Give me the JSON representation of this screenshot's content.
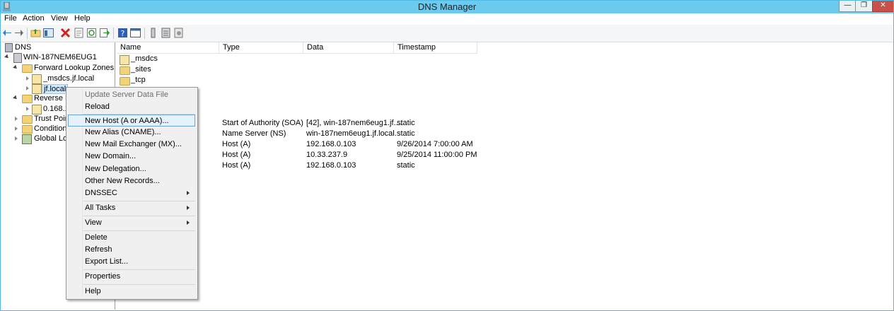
{
  "window": {
    "title": "DNS Manager",
    "controls": {
      "minimize": "—",
      "maximize": "❐",
      "close": "✕"
    }
  },
  "menubar": {
    "items": [
      "File",
      "Action",
      "View",
      "Help"
    ]
  },
  "toolbar": {
    "icons": [
      "back-icon",
      "forward-icon",
      "up-folder-icon",
      "show-hide-tree-icon",
      "delete-icon",
      "properties-icon",
      "refresh-icon",
      "export-icon",
      "help-icon",
      "console-view-icon",
      "server-icon",
      "list-icon",
      "settings-icon"
    ]
  },
  "tree": {
    "root": "DNS",
    "server": "WIN-187NEM6EUG1",
    "forward_zones": "Forward Lookup Zones",
    "zone_msdcs": "_msdcs.jf.local",
    "zone_jf": "jf.local",
    "reverse_zones": "Reverse Lo",
    "reverse_zone": "0.168.1",
    "trust_points": "Trust Point",
    "conditional": "Conditiona",
    "global_logs": "Global Log"
  },
  "list": {
    "columns": [
      "Name",
      "Type",
      "Data",
      "Timestamp"
    ],
    "folders": [
      "_msdcs",
      "_sites",
      "_tcp"
    ],
    "records": [
      {
        "type": "Start of Authority (SOA)",
        "data": "[42], win-187nem6eug1.jf....",
        "timestamp": "static"
      },
      {
        "type": "Name Server (NS)",
        "data": "win-187nem6eug1.jf.local.",
        "timestamp": "static"
      },
      {
        "type": "Host (A)",
        "data": "192.168.0.103",
        "timestamp": "9/26/2014 7:00:00 AM"
      },
      {
        "type": "Host (A)",
        "data": "10.33.237.9",
        "timestamp": "9/25/2014 11:00:00 PM"
      },
      {
        "type": "Host (A)",
        "data": "192.168.0.103",
        "timestamp": "static"
      }
    ]
  },
  "context_menu": {
    "items": [
      {
        "label": "Update Server Data File"
      },
      {
        "label": "Reload"
      },
      {
        "label": "New Host (A or AAAA)..."
      },
      {
        "label": "New Alias (CNAME)..."
      },
      {
        "label": "New Mail Exchanger (MX)..."
      },
      {
        "label": "New Domain..."
      },
      {
        "label": "New Delegation..."
      },
      {
        "label": "Other New Records..."
      },
      {
        "label": "DNSSEC"
      },
      {
        "label": "All Tasks"
      },
      {
        "label": "View"
      },
      {
        "label": "Delete"
      },
      {
        "label": "Refresh"
      },
      {
        "label": "Export List..."
      },
      {
        "label": "Properties"
      },
      {
        "label": "Help"
      }
    ]
  },
  "colors": {
    "titlebar": "#6ccaed",
    "close_button": "#c7524a",
    "menu_highlight": "#e5f1fb"
  }
}
